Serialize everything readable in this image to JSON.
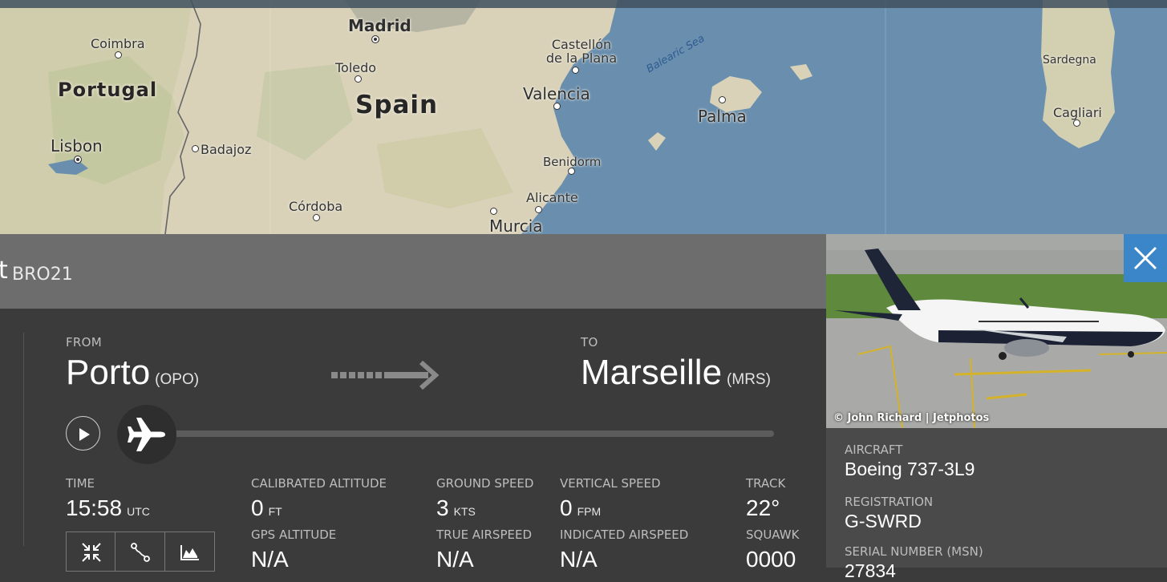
{
  "map": {
    "countries": [
      "Portugal",
      "Spain"
    ],
    "cities": [
      "Madrid",
      "Coimbra",
      "Castellón de la Plana",
      "Toledo",
      "Valencia",
      "Palma",
      "Sardegna",
      "Cagliari",
      "Lisbon",
      "Badajoz",
      "Benidorm",
      "Alicante",
      "Córdoba",
      "Murcia"
    ],
    "sea": "Balearic Sea"
  },
  "header": {
    "callsign_prefix": "t",
    "callsign": "BRO21"
  },
  "route": {
    "from_label": "FROM",
    "from_city": "Porto",
    "from_code": "(OPO)",
    "to_label": "TO",
    "to_city": "Marseille",
    "to_code": "(MRS)",
    "progress": 0.0
  },
  "stats": {
    "time_label": "TIME",
    "time_value": "15:58",
    "time_unit": "UTC",
    "cal_alt_label": "CALIBRATED ALTITUDE",
    "cal_alt_value": "0",
    "cal_alt_unit": "FT",
    "gps_alt_label": "GPS ALTITUDE",
    "gps_alt_value": "N/A",
    "ground_speed_label": "GROUND SPEED",
    "ground_speed_value": "3",
    "ground_speed_unit": "KTS",
    "true_airspeed_label": "TRUE AIRSPEED",
    "true_airspeed_value": "N/A",
    "vertical_speed_label": "VERTICAL SPEED",
    "vertical_speed_value": "0",
    "vertical_speed_unit": "FPM",
    "indicated_airspeed_label": "INDICATED AIRSPEED",
    "indicated_airspeed_value": "N/A",
    "track_label": "TRACK",
    "track_value": "22°",
    "squawk_label": "SQUAWK",
    "squawk_value": "0000"
  },
  "toolbar": {
    "icons": [
      "compress-icon",
      "route-icon",
      "chart-icon"
    ]
  },
  "aircraft": {
    "photo_credit": "© John Richard | Jetphotos",
    "photo_registration_mark": "G-SWRD",
    "aircraft_label": "AIRCRAFT",
    "aircraft_value": "Boeing 737-3L9",
    "registration_label": "REGISTRATION",
    "registration_value": "G-SWRD",
    "serial_label": "SERIAL NUMBER (MSN)",
    "serial_value": "27834"
  },
  "colors": {
    "accent_blue": "#3a86c8",
    "panel_dark": "#3b3b3b",
    "header_grey": "#6d6d6d",
    "side_grey": "#4a4a4a"
  }
}
